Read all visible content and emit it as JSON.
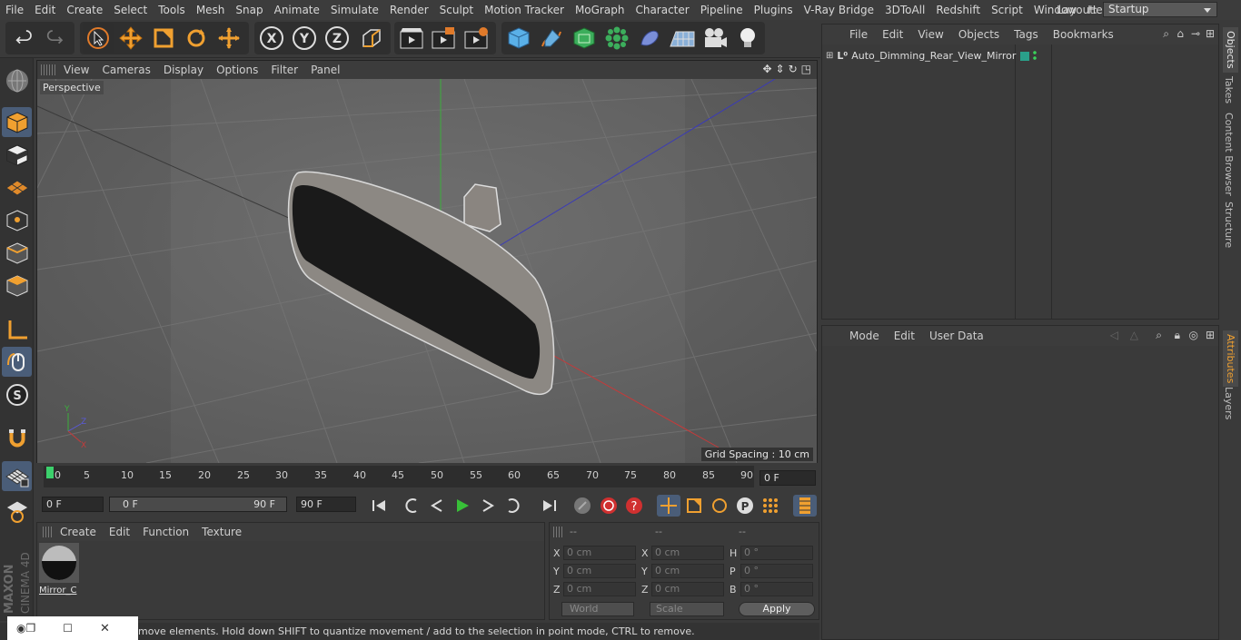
{
  "menubar": {
    "items": [
      "File",
      "Edit",
      "Create",
      "Select",
      "Tools",
      "Mesh",
      "Snap",
      "Animate",
      "Simulate",
      "Render",
      "Sculpt",
      "Motion Tracker",
      "MoGraph",
      "Character",
      "Pipeline",
      "Plugins",
      "V-Ray Bridge",
      "3DToAll",
      "Redshift",
      "Script",
      "Window",
      "Help"
    ],
    "layout_label": "Layout:",
    "layout_value": "Startup"
  },
  "viewport": {
    "menu": [
      "View",
      "Cameras",
      "Display",
      "Options",
      "Filter",
      "Panel"
    ],
    "camera_label": "Perspective",
    "grid_spacing": "Grid Spacing : 10 cm"
  },
  "timeline": {
    "ticks": [
      "0",
      "5",
      "10",
      "15",
      "20",
      "25",
      "30",
      "35",
      "40",
      "45",
      "50",
      "55",
      "60",
      "65",
      "70",
      "75",
      "80",
      "85",
      "90"
    ],
    "current_frame": "0 F",
    "start_field": "0 F",
    "range_start": "0 F",
    "range_end": "90 F",
    "end_field": "90 F"
  },
  "material": {
    "menu": [
      "Create",
      "Edit",
      "Function",
      "Texture"
    ],
    "item_name": "Mirror_C"
  },
  "coords": {
    "headers": [
      "--",
      "--",
      "--"
    ],
    "rows": [
      {
        "a": "X",
        "v1": "0 cm",
        "b": "X",
        "v2": "0 cm",
        "c": "H",
        "v3": "0 °"
      },
      {
        "a": "Y",
        "v1": "0 cm",
        "b": "Y",
        "v2": "0 cm",
        "c": "P",
        "v3": "0 °"
      },
      {
        "a": "Z",
        "v1": "0 cm",
        "b": "Z",
        "v2": "0 cm",
        "c": "B",
        "v3": "0 °"
      }
    ],
    "world": "World",
    "scale": "Scale",
    "apply": "Apply"
  },
  "objects": {
    "menu": [
      "File",
      "Edit",
      "View",
      "Objects",
      "Tags",
      "Bookmarks"
    ],
    "item": "Auto_Dimming_Rear_View_Mirror"
  },
  "attributes": {
    "menu": [
      "Mode",
      "Edit",
      "User Data"
    ]
  },
  "sidetabs": [
    "Objects",
    "Takes",
    "Content Browser",
    "Structure"
  ],
  "sidetabs2": [
    "Attributes",
    "Layers"
  ],
  "status": "move elements. Hold down SHIFT to quantize movement / add to the selection in point mode, CTRL to remove.",
  "brand": {
    "line1": "MAXON",
    "line2": "CINEMA 4D"
  },
  "colors": {
    "accent": "#4a5d78",
    "xaxis": "#c53a3a",
    "yaxis": "#3cae3c",
    "zaxis": "#3a3ab8",
    "play": "#38c038"
  }
}
